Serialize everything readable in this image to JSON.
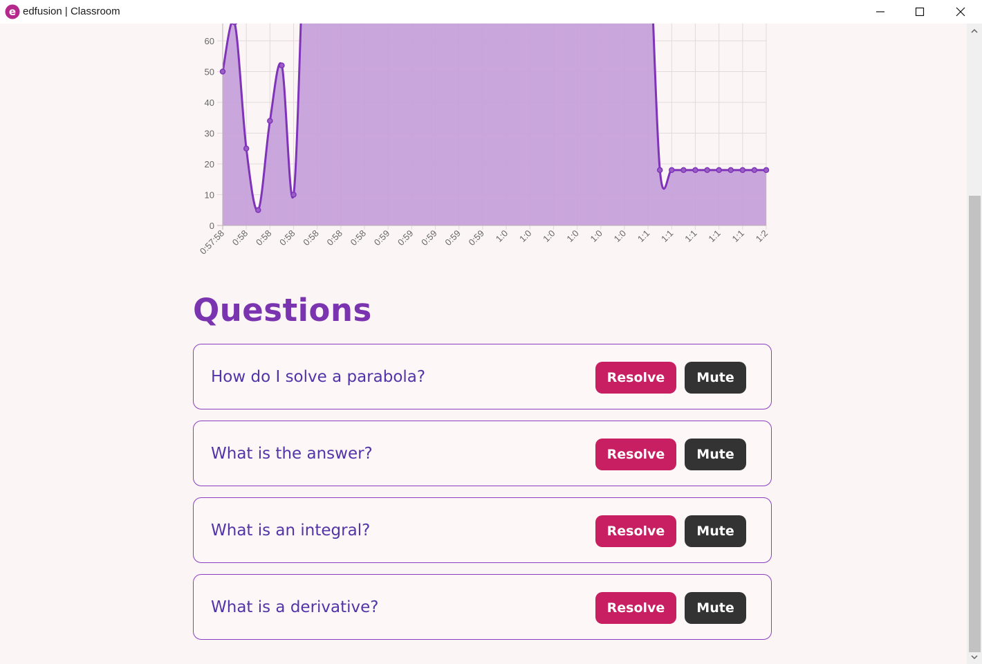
{
  "window": {
    "title": "edfusion | Classroom",
    "logo_letter": "e"
  },
  "colors": {
    "accent": "#7b34b0",
    "line": "#7f33b8",
    "fill": "#c6a1da",
    "resolve": "#c71f62",
    "mute": "#333333",
    "question_text": "#5134a8"
  },
  "chart_data": {
    "type": "area",
    "y_ticks": [
      0,
      10,
      20,
      30,
      40,
      50,
      60
    ],
    "ylim": [
      0,
      60
    ],
    "grid": true,
    "x_tick_labels": [
      "0:57:58",
      "0:58",
      "0:58",
      "0:58",
      "0:58",
      "0:58",
      "0:58",
      "0:59",
      "0:59",
      "0:59",
      "0:59",
      "0:59",
      "1:0",
      "1:0",
      "1:0",
      "1:0",
      "1:0",
      "1:0",
      "1:1",
      "1:1",
      "1:1",
      "1:1",
      "1:1",
      "1:2"
    ],
    "values": [
      50,
      66,
      25,
      5,
      34,
      52,
      10,
      100,
      100,
      100,
      100,
      100,
      100,
      100,
      100,
      100,
      100,
      100,
      100,
      100,
      100,
      100,
      100,
      100,
      100,
      100,
      100,
      100,
      100,
      100,
      100,
      100,
      100,
      100,
      100,
      100,
      100,
      18,
      18,
      18,
      18,
      18,
      18,
      18,
      18,
      18,
      18
    ]
  },
  "questions": {
    "title": "Questions",
    "items": [
      {
        "text": "How do I solve a parabola?",
        "resolve_label": "Resolve",
        "mute_label": "Mute"
      },
      {
        "text": "What is the answer?",
        "resolve_label": "Resolve",
        "mute_label": "Mute"
      },
      {
        "text": "What is an integral?",
        "resolve_label": "Resolve",
        "mute_label": "Mute"
      },
      {
        "text": "What is a derivative?",
        "resolve_label": "Resolve",
        "mute_label": "Mute"
      }
    ]
  }
}
